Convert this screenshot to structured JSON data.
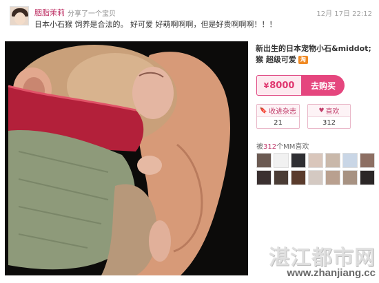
{
  "post": {
    "username": "胭脂茉莉",
    "share_text": "分享了一个宝贝",
    "timestamp": "12月 17日 22:12",
    "caption": "日本小石猴 饲养是合法的。 好可爱 好萌啊啊啊，但是好贵啊啊啊！！！"
  },
  "product": {
    "title": "新出生的日本宠物小石&middot;猴 超级可爱",
    "store_badge": "淘",
    "price": "8000",
    "currency": "¥",
    "buy_label": "去购买"
  },
  "stats": {
    "collect_label": "收进杂志",
    "collect_count": "21",
    "like_label": "喜欢",
    "like_count": "312"
  },
  "likes": {
    "prefix": "被",
    "count": "312",
    "suffix": "个MM喜欢"
  },
  "likers_avatars": [
    {
      "color": "#6b5a52"
    },
    {
      "color": "#f1f1f1"
    },
    {
      "color": "#2f2f33"
    },
    {
      "color": "#d9c6bb"
    },
    {
      "color": "#c9b8aa"
    },
    {
      "color": "#c9d6e6"
    },
    {
      "color": "#8d6f63"
    },
    {
      "color": "#3a3030"
    },
    {
      "color": "#4a3c35"
    },
    {
      "color": "#5a3b2c"
    },
    {
      "color": "#d4c9c2"
    },
    {
      "color": "#b9a08f"
    },
    {
      "color": "#a79282"
    },
    {
      "color": "#2b2626"
    }
  ],
  "watermark": {
    "brand": "湛江都市网",
    "url": "www.zhanjiang.cc"
  }
}
